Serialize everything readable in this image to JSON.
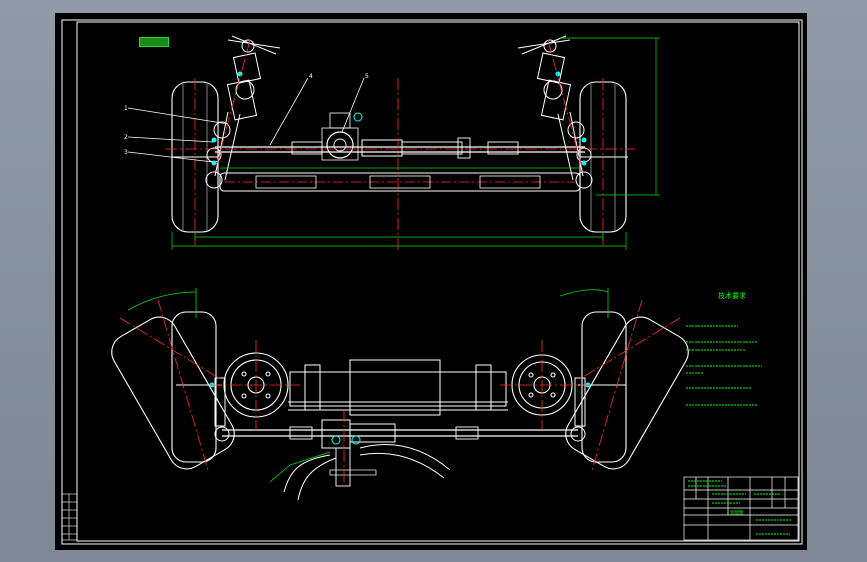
{
  "colors": {
    "background": "#8f9aa6",
    "sheet": "#000000",
    "frame": "#ffffff",
    "centerline": "#ff2a2a",
    "dimension": "#00e000",
    "callout": "#ffffff",
    "notes": "#00ff00",
    "accent": "#00ffff"
  },
  "callouts": [
    "1",
    "2",
    "3",
    "4",
    "5"
  ],
  "notes_heading": "技术要求",
  "title_block_label": "装配图"
}
